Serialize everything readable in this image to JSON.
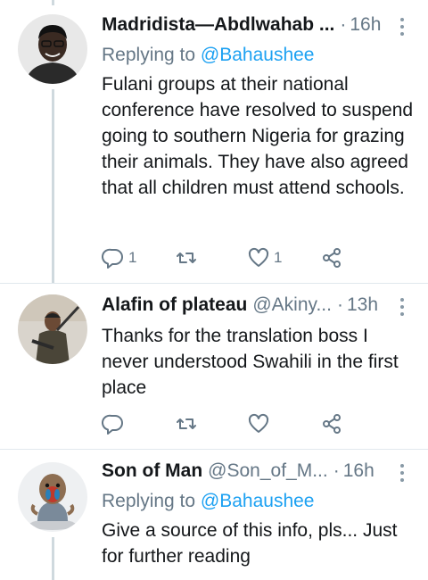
{
  "tweets": [
    {
      "name": "Madridista—Abdlwahab ...",
      "handle": "",
      "time": "16h",
      "replying_prefix": "Replying to",
      "replying_to": "@Bahaushee",
      "text": "Fulani groups at their national conference have resolved to suspend going to southern Nigeria for grazing their animals. They have also agreed that all children must attend schools.",
      "reply_count": "1",
      "retweet_count": "",
      "like_count": "1"
    },
    {
      "name": "Alafin of plateau",
      "handle": "@Akiny...",
      "time": "13h",
      "text": "Thanks for the translation boss I never understood Swahili in the first place",
      "reply_count": "",
      "retweet_count": "",
      "like_count": ""
    },
    {
      "name": "Son of Man",
      "handle": "@Son_of_M...",
      "time": "16h",
      "replying_prefix": "Replying to",
      "replying_to": "@Bahaushee",
      "text": "Give a source of this info, pls... Just for further reading"
    }
  ],
  "separator": "·",
  "icons": [
    "reply-icon",
    "retweet-icon",
    "like-icon",
    "share-icon",
    "more-icon"
  ],
  "colors": {
    "accent": "#1da1f2",
    "secondary_text": "#657786",
    "divider": "#e1e8ed"
  }
}
